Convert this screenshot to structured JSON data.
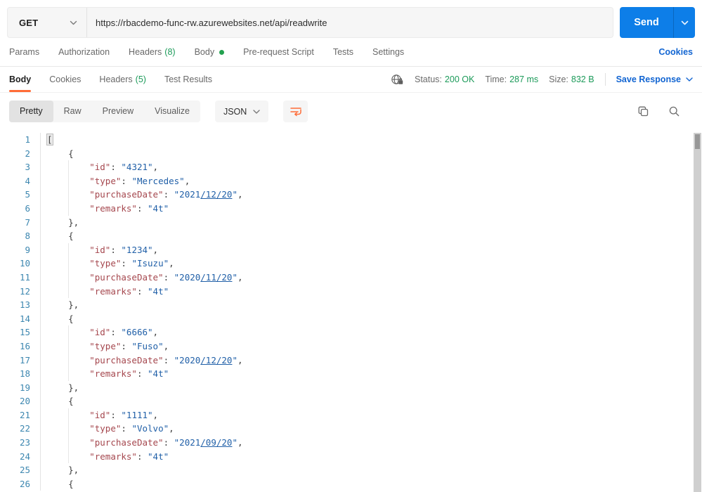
{
  "request": {
    "method": "GET",
    "url": "https://rbacdemo-func-rw.azurewebsites.net/api/readwrite",
    "send_label": "Send"
  },
  "request_tabs": {
    "params": "Params",
    "authorization": "Authorization",
    "headers": "Headers",
    "headers_count": "(8)",
    "body": "Body",
    "pre_request": "Pre-request Script",
    "tests": "Tests",
    "settings": "Settings",
    "cookies_link": "Cookies"
  },
  "response": {
    "tabs": {
      "body": "Body",
      "cookies": "Cookies",
      "headers": "Headers",
      "headers_count": "(5)",
      "test_results": "Test Results"
    },
    "meta": {
      "status_label": "Status:",
      "status_value": "200 OK",
      "time_label": "Time:",
      "time_value": "287 ms",
      "size_label": "Size:",
      "size_value": "832 B",
      "save_label": "Save Response"
    },
    "views": {
      "pretty": "Pretty",
      "raw": "Raw",
      "preview": "Preview",
      "visualize": "Visualize",
      "language": "JSON"
    }
  },
  "icons": {
    "method_caret": "chevron-down",
    "send_caret": "chevron-down",
    "save_caret": "chevron-down",
    "language_caret": "chevron-down",
    "network": "globe-lock",
    "wrap": "wrap-text",
    "copy": "copy",
    "search": "magnifier"
  },
  "colors": {
    "accent_orange": "#ff6c37",
    "send_blue": "#0d7ee8",
    "link_blue": "#1265d2",
    "success_green": "#1b9a59",
    "json_key": "#a5474e",
    "json_string": "#2160a8",
    "line_number": "#3d87b0"
  },
  "editor": {
    "lines": [
      {
        "n": 1,
        "tokens": [
          {
            "t": "b",
            "v": "["
          }
        ]
      },
      {
        "n": 2,
        "tokens": [
          {
            "t": "p",
            "v": "    {"
          }
        ]
      },
      {
        "n": 3,
        "g": true,
        "tokens": [
          {
            "t": "p",
            "v": "        "
          },
          {
            "t": "k",
            "v": "\"id\""
          },
          {
            "t": "p",
            "v": ": "
          },
          {
            "t": "s",
            "v": "\"4321\""
          },
          {
            "t": "p",
            "v": ","
          }
        ]
      },
      {
        "n": 4,
        "g": true,
        "tokens": [
          {
            "t": "p",
            "v": "        "
          },
          {
            "t": "k",
            "v": "\"type\""
          },
          {
            "t": "p",
            "v": ": "
          },
          {
            "t": "s",
            "v": "\"Mercedes\""
          },
          {
            "t": "p",
            "v": ","
          }
        ]
      },
      {
        "n": 5,
        "g": true,
        "tokens": [
          {
            "t": "p",
            "v": "        "
          },
          {
            "t": "k",
            "v": "\"purchaseDate\""
          },
          {
            "t": "p",
            "v": ": "
          },
          {
            "t": "s",
            "v": "\"2021"
          },
          {
            "t": "u",
            "v": "/12/20"
          },
          {
            "t": "s",
            "v": "\""
          },
          {
            "t": "p",
            "v": ","
          }
        ]
      },
      {
        "n": 6,
        "g": true,
        "tokens": [
          {
            "t": "p",
            "v": "        "
          },
          {
            "t": "k",
            "v": "\"remarks\""
          },
          {
            "t": "p",
            "v": ": "
          },
          {
            "t": "s",
            "v": "\"4t\""
          }
        ]
      },
      {
        "n": 7,
        "tokens": [
          {
            "t": "p",
            "v": "    },"
          }
        ]
      },
      {
        "n": 8,
        "tokens": [
          {
            "t": "p",
            "v": "    {"
          }
        ]
      },
      {
        "n": 9,
        "g": true,
        "tokens": [
          {
            "t": "p",
            "v": "        "
          },
          {
            "t": "k",
            "v": "\"id\""
          },
          {
            "t": "p",
            "v": ": "
          },
          {
            "t": "s",
            "v": "\"1234\""
          },
          {
            "t": "p",
            "v": ","
          }
        ]
      },
      {
        "n": 10,
        "g": true,
        "tokens": [
          {
            "t": "p",
            "v": "        "
          },
          {
            "t": "k",
            "v": "\"type\""
          },
          {
            "t": "p",
            "v": ": "
          },
          {
            "t": "s",
            "v": "\"Isuzu\""
          },
          {
            "t": "p",
            "v": ","
          }
        ]
      },
      {
        "n": 11,
        "g": true,
        "tokens": [
          {
            "t": "p",
            "v": "        "
          },
          {
            "t": "k",
            "v": "\"purchaseDate\""
          },
          {
            "t": "p",
            "v": ": "
          },
          {
            "t": "s",
            "v": "\"2020"
          },
          {
            "t": "u",
            "v": "/11/20"
          },
          {
            "t": "s",
            "v": "\""
          },
          {
            "t": "p",
            "v": ","
          }
        ]
      },
      {
        "n": 12,
        "g": true,
        "tokens": [
          {
            "t": "p",
            "v": "        "
          },
          {
            "t": "k",
            "v": "\"remarks\""
          },
          {
            "t": "p",
            "v": ": "
          },
          {
            "t": "s",
            "v": "\"4t\""
          }
        ]
      },
      {
        "n": 13,
        "tokens": [
          {
            "t": "p",
            "v": "    },"
          }
        ]
      },
      {
        "n": 14,
        "tokens": [
          {
            "t": "p",
            "v": "    {"
          }
        ]
      },
      {
        "n": 15,
        "g": true,
        "tokens": [
          {
            "t": "p",
            "v": "        "
          },
          {
            "t": "k",
            "v": "\"id\""
          },
          {
            "t": "p",
            "v": ": "
          },
          {
            "t": "s",
            "v": "\"6666\""
          },
          {
            "t": "p",
            "v": ","
          }
        ]
      },
      {
        "n": 16,
        "g": true,
        "tokens": [
          {
            "t": "p",
            "v": "        "
          },
          {
            "t": "k",
            "v": "\"type\""
          },
          {
            "t": "p",
            "v": ": "
          },
          {
            "t": "s",
            "v": "\"Fuso\""
          },
          {
            "t": "p",
            "v": ","
          }
        ]
      },
      {
        "n": 17,
        "g": true,
        "tokens": [
          {
            "t": "p",
            "v": "        "
          },
          {
            "t": "k",
            "v": "\"purchaseDate\""
          },
          {
            "t": "p",
            "v": ": "
          },
          {
            "t": "s",
            "v": "\"2020"
          },
          {
            "t": "u",
            "v": "/12/20"
          },
          {
            "t": "s",
            "v": "\""
          },
          {
            "t": "p",
            "v": ","
          }
        ]
      },
      {
        "n": 18,
        "g": true,
        "tokens": [
          {
            "t": "p",
            "v": "        "
          },
          {
            "t": "k",
            "v": "\"remarks\""
          },
          {
            "t": "p",
            "v": ": "
          },
          {
            "t": "s",
            "v": "\"4t\""
          }
        ]
      },
      {
        "n": 19,
        "tokens": [
          {
            "t": "p",
            "v": "    },"
          }
        ]
      },
      {
        "n": 20,
        "tokens": [
          {
            "t": "p",
            "v": "    {"
          }
        ]
      },
      {
        "n": 21,
        "g": true,
        "tokens": [
          {
            "t": "p",
            "v": "        "
          },
          {
            "t": "k",
            "v": "\"id\""
          },
          {
            "t": "p",
            "v": ": "
          },
          {
            "t": "s",
            "v": "\"1111\""
          },
          {
            "t": "p",
            "v": ","
          }
        ]
      },
      {
        "n": 22,
        "g": true,
        "tokens": [
          {
            "t": "p",
            "v": "        "
          },
          {
            "t": "k",
            "v": "\"type\""
          },
          {
            "t": "p",
            "v": ": "
          },
          {
            "t": "s",
            "v": "\"Volvo\""
          },
          {
            "t": "p",
            "v": ","
          }
        ]
      },
      {
        "n": 23,
        "g": true,
        "tokens": [
          {
            "t": "p",
            "v": "        "
          },
          {
            "t": "k",
            "v": "\"purchaseDate\""
          },
          {
            "t": "p",
            "v": ": "
          },
          {
            "t": "s",
            "v": "\"2021"
          },
          {
            "t": "u",
            "v": "/09/20"
          },
          {
            "t": "s",
            "v": "\""
          },
          {
            "t": "p",
            "v": ","
          }
        ]
      },
      {
        "n": 24,
        "g": true,
        "tokens": [
          {
            "t": "p",
            "v": "        "
          },
          {
            "t": "k",
            "v": "\"remarks\""
          },
          {
            "t": "p",
            "v": ": "
          },
          {
            "t": "s",
            "v": "\"4t\""
          }
        ]
      },
      {
        "n": 25,
        "tokens": [
          {
            "t": "p",
            "v": "    },"
          }
        ]
      },
      {
        "n": 26,
        "tokens": [
          {
            "t": "p",
            "v": "    {"
          }
        ]
      }
    ]
  }
}
